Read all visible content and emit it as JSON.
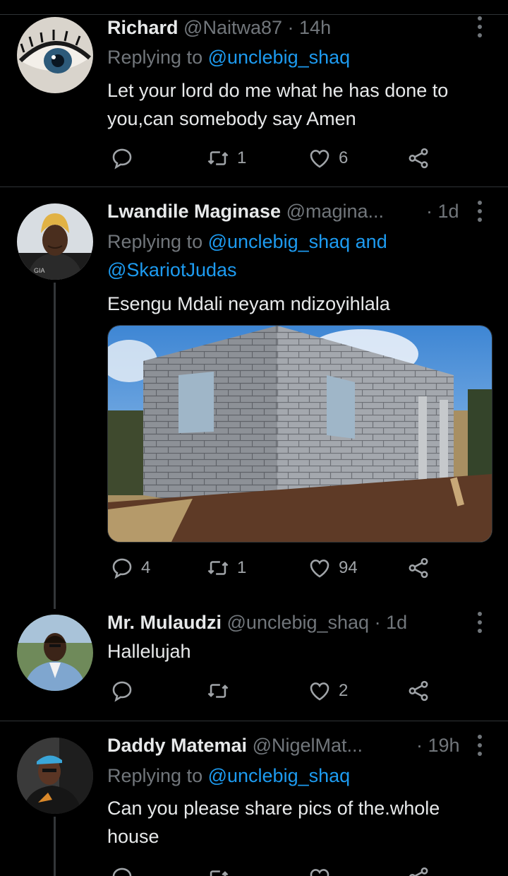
{
  "tweets": [
    {
      "name": "Richard",
      "handle": "@Naitwa87",
      "time": "· 14h",
      "replying_prefix": "Replying to ",
      "replying_to": "@unclebig_shaq",
      "text_lines": [
        "Let your lord do me what he has done to",
        "you,can somebody say Amen"
      ],
      "replies": "",
      "retweets": "1",
      "likes": "6"
    },
    {
      "name": "Lwandile Maginase",
      "handle": "@magina...",
      "time": "· 1d",
      "replying_prefix": "Replying to ",
      "replying_to": "@unclebig_shaq",
      "replying_and": " and",
      "replying_to_2": "@SkariotJudas",
      "text_lines": [
        "Esengu Mdali neyam ndizoyihlala"
      ],
      "replies": "4",
      "retweets": "1",
      "likes": "94"
    },
    {
      "name": "Mr. Mulaudzi",
      "handle": "@unclebig_shaq",
      "time": "· 1d",
      "text_lines": [
        "Hallelujah"
      ],
      "replies": "",
      "retweets": "",
      "likes": "2"
    },
    {
      "name": "Daddy Matemai",
      "handle": "@NigelMat...",
      "time": "· 19h",
      "replying_prefix": "Replying to ",
      "replying_to": "@unclebig_shaq",
      "text_lines": [
        "Can you please share pics of the.whole",
        "house"
      ]
    }
  ],
  "colors": {
    "background": "#000000",
    "link": "#1d9bf0",
    "secondary_text": "#71767b",
    "divider": "#2f3336"
  },
  "icons": [
    "reply-icon",
    "retweet-icon",
    "like-icon",
    "share-icon",
    "more-icon"
  ]
}
